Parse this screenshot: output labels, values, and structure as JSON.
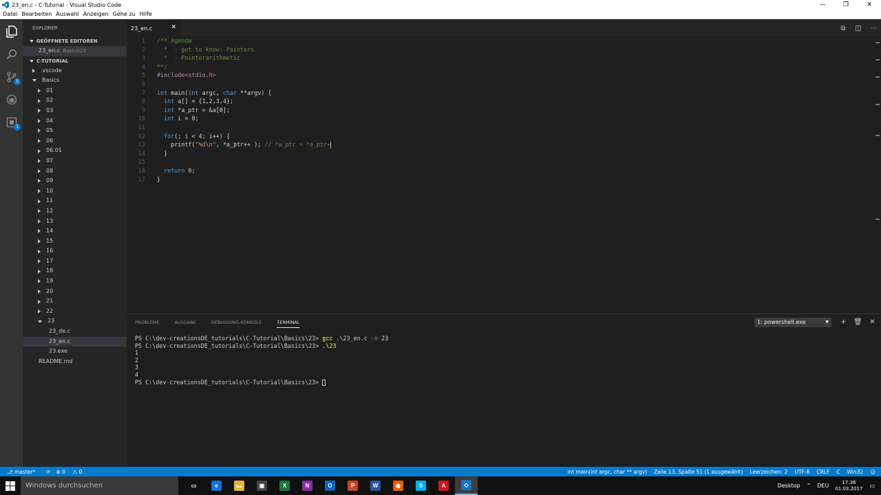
{
  "window": {
    "title": "23_en.c - C-Tutorial - Visual Studio Code",
    "minimize": "—",
    "restore": "❐",
    "close": "✕"
  },
  "menu": [
    "Datei",
    "Bearbeiten",
    "Auswahl",
    "Anzeigen",
    "Gehe zu",
    "Hilfe"
  ],
  "activity": {
    "git_badge": "5",
    "extensions_badge": "1"
  },
  "sidebar": {
    "title": "EXPLORER",
    "open_editors_label": "GEÖFFNETE EDITOREN",
    "open_editor": {
      "name": "23_en.c",
      "path": "Basics\\23"
    },
    "project_label": "C-TUTORIAL",
    "tree": [
      {
        "label": ".vscode",
        "indent": 1,
        "arrow": "right"
      },
      {
        "label": "Basics",
        "indent": 1,
        "arrow": "down"
      },
      {
        "label": "01",
        "indent": 2,
        "arrow": "right"
      },
      {
        "label": "02",
        "indent": 2,
        "arrow": "right"
      },
      {
        "label": "03",
        "indent": 2,
        "arrow": "right"
      },
      {
        "label": "04",
        "indent": 2,
        "arrow": "right"
      },
      {
        "label": "05",
        "indent": 2,
        "arrow": "right"
      },
      {
        "label": "06",
        "indent": 2,
        "arrow": "right"
      },
      {
        "label": "06.01",
        "indent": 2,
        "arrow": "right"
      },
      {
        "label": "07",
        "indent": 2,
        "arrow": "right"
      },
      {
        "label": "08",
        "indent": 2,
        "arrow": "right"
      },
      {
        "label": "09",
        "indent": 2,
        "arrow": "right"
      },
      {
        "label": "10",
        "indent": 2,
        "arrow": "right"
      },
      {
        "label": "11",
        "indent": 2,
        "arrow": "right"
      },
      {
        "label": "12",
        "indent": 2,
        "arrow": "right"
      },
      {
        "label": "13",
        "indent": 2,
        "arrow": "right"
      },
      {
        "label": "14",
        "indent": 2,
        "arrow": "right"
      },
      {
        "label": "15",
        "indent": 2,
        "arrow": "right"
      },
      {
        "label": "16",
        "indent": 2,
        "arrow": "right"
      },
      {
        "label": "17",
        "indent": 2,
        "arrow": "right"
      },
      {
        "label": "18",
        "indent": 2,
        "arrow": "right"
      },
      {
        "label": "19",
        "indent": 2,
        "arrow": "right"
      },
      {
        "label": "20",
        "indent": 2,
        "arrow": "right"
      },
      {
        "label": "21",
        "indent": 2,
        "arrow": "right"
      },
      {
        "label": "22",
        "indent": 2,
        "arrow": "right"
      },
      {
        "label": "23",
        "indent": 2,
        "arrow": "down"
      },
      {
        "label": "23_de.c",
        "indent": 3,
        "arrow": "none"
      },
      {
        "label": "23_en.c",
        "indent": 3,
        "arrow": "none",
        "selected": true
      },
      {
        "label": "23.exe",
        "indent": 3,
        "arrow": "none"
      },
      {
        "label": "README.md",
        "indent": 1,
        "arrow": "none"
      }
    ]
  },
  "tab": {
    "label": "23_en.c",
    "close": "✕"
  },
  "code": [
    [
      [
        "c-comment",
        "/** Agenda"
      ]
    ],
    [
      [
        "c-comment",
        "  *  - get to know: Pointers"
      ]
    ],
    [
      [
        "c-comment",
        "  *  - Pointerarithmetic"
      ]
    ],
    [
      [
        "c-comment",
        "**/"
      ]
    ],
    [
      [
        "c-pre",
        "#include<stdio.h>"
      ]
    ],
    [],
    [
      [
        "c-kw",
        "int"
      ],
      [
        "c-txt",
        " main("
      ],
      [
        "c-kw",
        "int"
      ],
      [
        "c-txt",
        " argc, "
      ],
      [
        "c-kw",
        "char"
      ],
      [
        "c-txt",
        " **argv) {"
      ]
    ],
    [
      [
        "c-txt",
        "  "
      ],
      [
        "c-kw",
        "int"
      ],
      [
        "c-txt",
        " a[] = {1,2,3,4};"
      ]
    ],
    [
      [
        "c-txt",
        "  "
      ],
      [
        "c-kw",
        "int"
      ],
      [
        "c-txt",
        " *a_ptr = &a[0];"
      ]
    ],
    [
      [
        "c-txt",
        "  "
      ],
      [
        "c-kw",
        "int"
      ],
      [
        "c-txt",
        " i = 0;"
      ]
    ],
    [],
    [
      [
        "c-txt",
        "  "
      ],
      [
        "c-kw",
        "for"
      ],
      [
        "c-txt",
        "(; i < 4; i++) {"
      ]
    ],
    [
      [
        "c-txt",
        "    printf("
      ],
      [
        "c-str",
        "\"%d\\n\""
      ],
      [
        "c-txt",
        ", *a_ptr++ ); "
      ],
      [
        "c-comment",
        "// *a_ptr = *a_ptr+"
      ]
    ],
    [
      [
        "c-txt",
        "  }"
      ]
    ],
    [],
    [
      [
        "c-txt",
        "  "
      ],
      [
        "c-kw",
        "return"
      ],
      [
        "c-txt",
        " 0;"
      ]
    ],
    [
      [
        "c-txt",
        "}"
      ]
    ]
  ],
  "cursor_line": 13,
  "panel": {
    "tabs": [
      "PROBLEME",
      "AUSGABE",
      "DEBUGGING-KONSOLE",
      "TERMINAL"
    ],
    "active_tab": "TERMINAL",
    "terminal_select": "1: powershell.exe",
    "new_terminal": "+",
    "delete_terminal": "🗑",
    "close_panel": "✕"
  },
  "terminal": {
    "prompt": "PS C:\\dev-creationsDE_tutorials\\C-Tutorial\\Basics\\23> ",
    "cmd1": "gcc",
    "cmd1_args": " .\\23_en.c ",
    "cmd1_flag": "-o",
    "cmd1_out": " 23",
    "cmd2": ".\\23",
    "output": [
      "1",
      "2",
      "3",
      "4"
    ]
  },
  "status": {
    "branch": "master*",
    "errors": "0",
    "warnings": "0",
    "function": "int main(int argc, char ** argv)",
    "position": "Zeile 13, Spalte 51 (1 ausgewählt)",
    "indent": "Leerzeichen: 2",
    "encoding": "UTF-8",
    "eol": "CRLF",
    "language": "C",
    "platform": "Win32",
    "smiley": "☺"
  },
  "taskbar": {
    "search_placeholder": "Windows durchsuchen",
    "desktop_label": "Desktop",
    "language": "DEU",
    "time": "17:36",
    "date": "01.03.2017",
    "apps": [
      {
        "name": "task-view",
        "label": "▭",
        "color": "#101010"
      },
      {
        "name": "edge",
        "label": "e",
        "color": "#1672d4"
      },
      {
        "name": "file-explorer",
        "label": "▬",
        "color": "#e8b33a"
      },
      {
        "name": "store",
        "label": "▣",
        "color": "#444444"
      },
      {
        "name": "excel",
        "label": "X",
        "color": "#1d7044"
      },
      {
        "name": "onenote",
        "label": "N",
        "color": "#8a2ea8"
      },
      {
        "name": "outlook",
        "label": "O",
        "color": "#0a64b8"
      },
      {
        "name": "powerpoint",
        "label": "P",
        "color": "#c8452a"
      },
      {
        "name": "word",
        "label": "W",
        "color": "#2a5699"
      },
      {
        "name": "firefox",
        "label": "◉",
        "color": "#e66000"
      },
      {
        "name": "skype",
        "label": "S",
        "color": "#00aff0"
      },
      {
        "name": "acrobat",
        "label": "A",
        "color": "#c9151e"
      },
      {
        "name": "vscode",
        "label": "◇",
        "color": "#1a74b8"
      }
    ],
    "active_app": "vscode"
  }
}
